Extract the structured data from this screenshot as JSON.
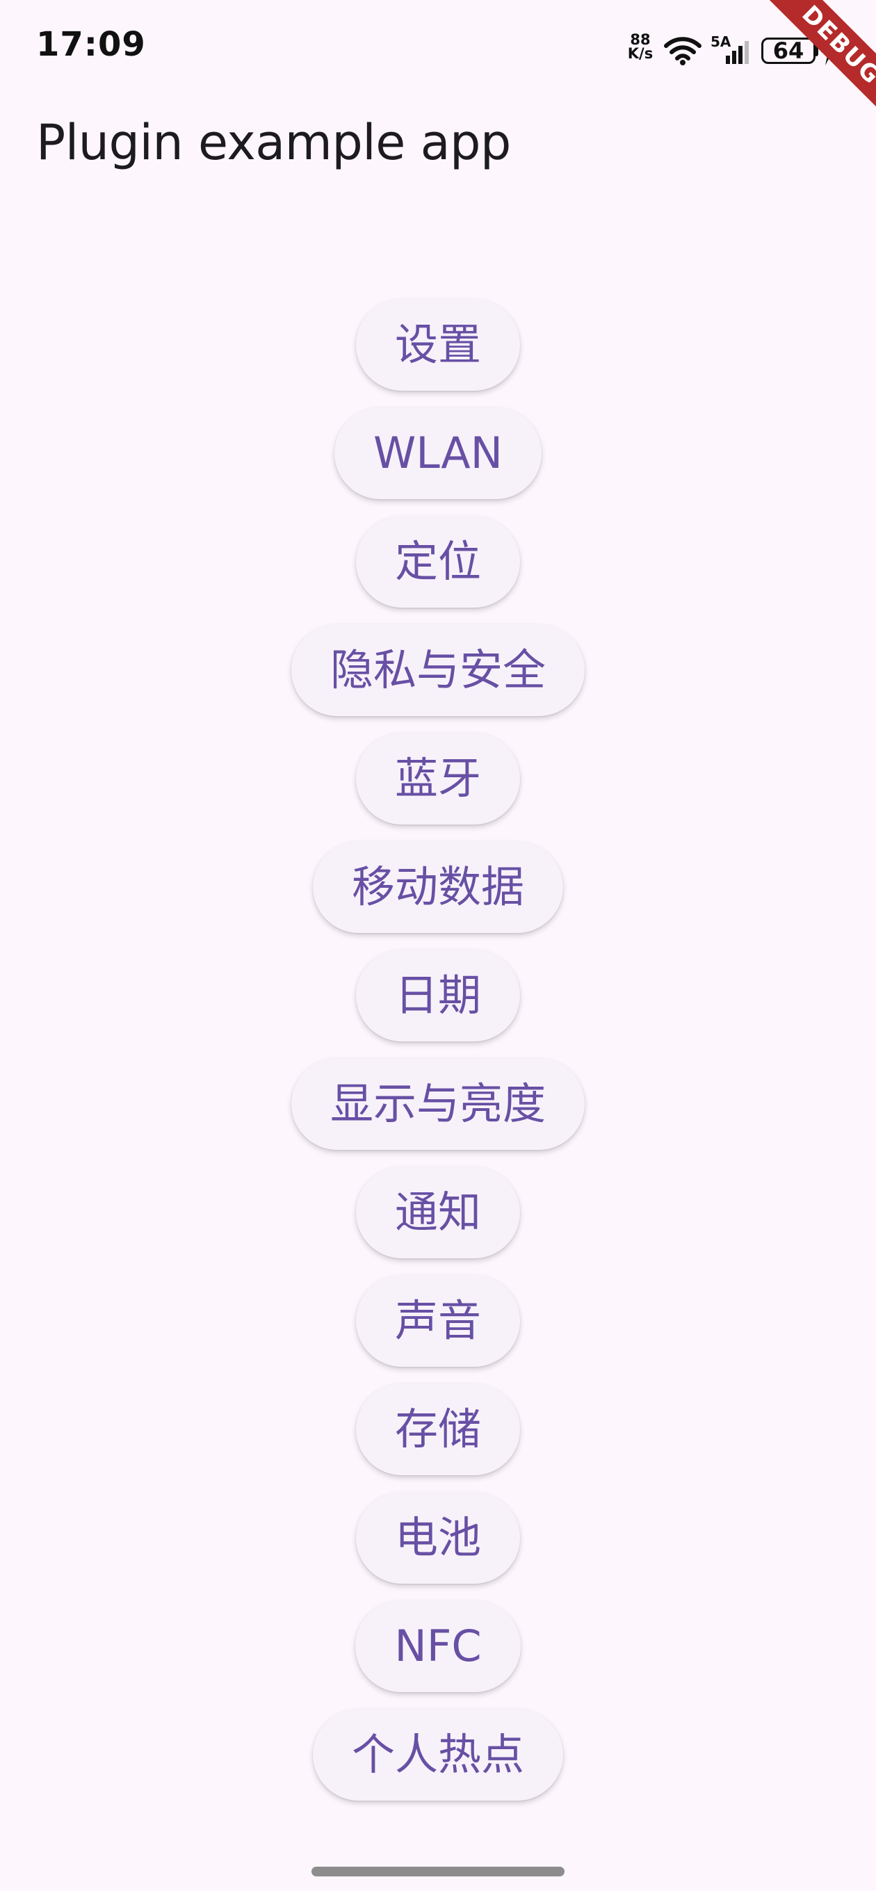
{
  "status_bar": {
    "time": "17:09",
    "network_speed_value": "88",
    "network_speed_unit": "K/s",
    "signal_label": "5A",
    "battery": "64",
    "icons": [
      "wifi-icon",
      "signal-icon",
      "battery-icon",
      "charging-bolt-icon"
    ]
  },
  "debug_banner": "DEBUG",
  "app_title": "Plugin example app",
  "buttons": [
    "设置",
    "WLAN",
    "定位",
    "隐私与安全",
    "蓝牙",
    "移动数据",
    "日期",
    "显示与亮度",
    "通知",
    "声音",
    "存储",
    "电池",
    "NFC",
    "个人热点"
  ],
  "colors": {
    "background": "#fdf7fd",
    "button_background": "#f7f2fa",
    "button_text": "#6750a4",
    "title_text": "#1d1b20",
    "debug_banner": "#b52a2a"
  }
}
